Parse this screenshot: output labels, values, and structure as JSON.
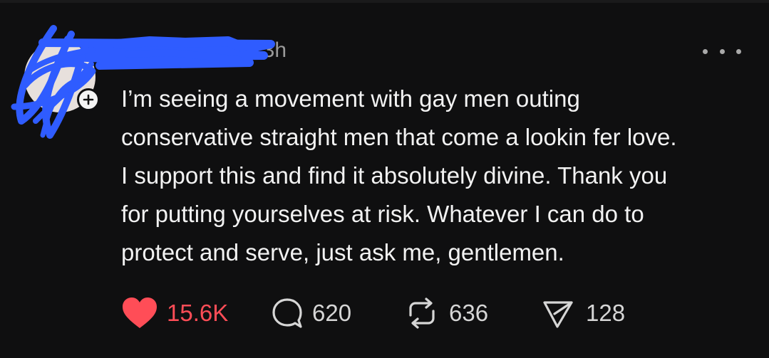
{
  "post": {
    "username": "",
    "timestamp": "13h",
    "text": "I’m seeing a movement with gay men outing\nconservative straight men that come a lookin fer love.\nI support this and find it absolutely divine. Thank you\nfor putting yourselves at risk. Whatever I can do to\nprotect and serve, just ask me, gentlemen.",
    "more_icon": "more-horizontal-icon"
  },
  "actions": {
    "likes": "15.6K",
    "comments": "620",
    "reposts": "636",
    "shares": "128",
    "like_icon": "heart-filled-icon",
    "comment_icon": "comment-bubble-icon",
    "repost_icon": "repost-arrows-icon",
    "share_icon": "send-paper-plane-icon"
  },
  "colors": {
    "background": "#0f0f10",
    "text": "#f2f2f2",
    "muted": "#9a9a9a",
    "like_red": "#ff4d57",
    "redaction_blue": "#2f5cff"
  }
}
